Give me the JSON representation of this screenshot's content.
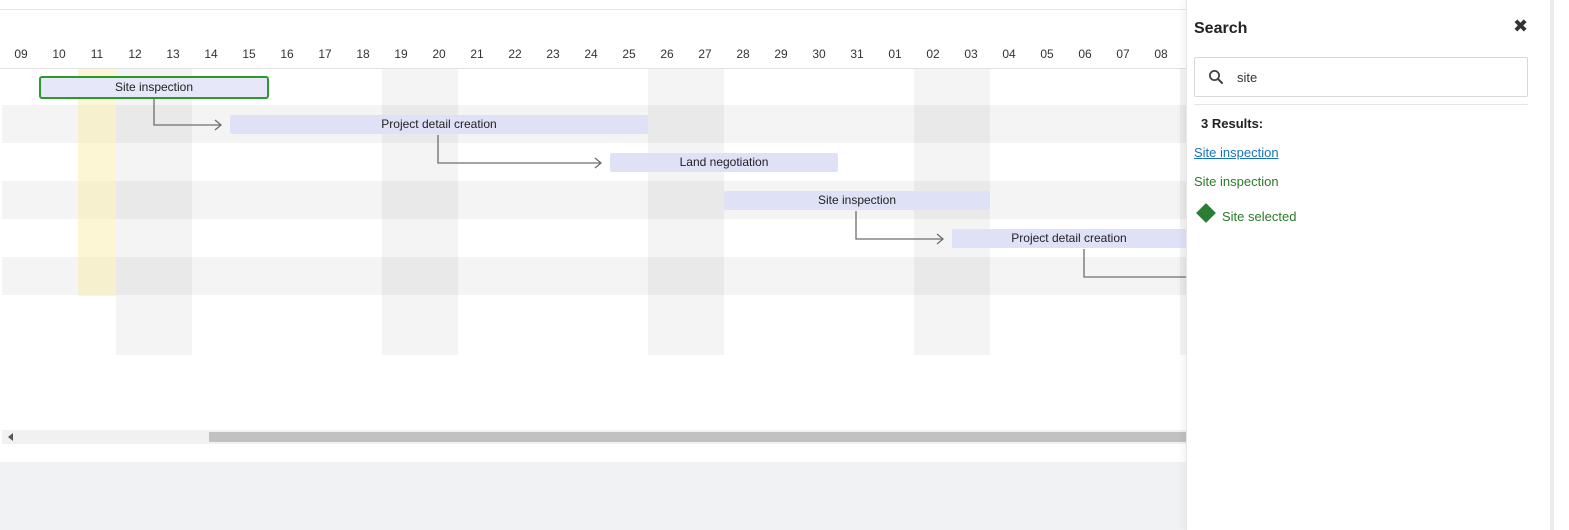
{
  "timescale": {
    "days": [
      "09",
      "10",
      "11",
      "12",
      "13",
      "14",
      "15",
      "16",
      "17",
      "18",
      "19",
      "20",
      "21",
      "22",
      "23",
      "24",
      "25",
      "26",
      "27",
      "28",
      "29",
      "30",
      "31",
      "01",
      "02",
      "03",
      "04",
      "05",
      "06",
      "07",
      "08"
    ]
  },
  "tasks": [
    {
      "label": "Site inspection",
      "selected": true
    },
    {
      "label": "Project detail creation",
      "selected": false
    },
    {
      "label": "Land negotiation",
      "selected": false
    },
    {
      "label": "Site inspection",
      "selected": false
    },
    {
      "label": "Project detail creation",
      "selected": false
    }
  ],
  "search_panel": {
    "title": "Search",
    "query": "site",
    "results_count": "3 Results:",
    "results": [
      {
        "label": "Site inspection",
        "style": "link"
      },
      {
        "label": "Site inspection",
        "style": "plain"
      },
      {
        "label": "Site selected",
        "style": "milestone"
      }
    ]
  },
  "colors": {
    "task_bar": "#dfe1f7",
    "selected_border": "#2a9a2a",
    "link_blue": "#1a73b8",
    "result_green": "#2a7a2a",
    "milestone": "#2b7d34",
    "today_highlight": "#faeba0"
  }
}
